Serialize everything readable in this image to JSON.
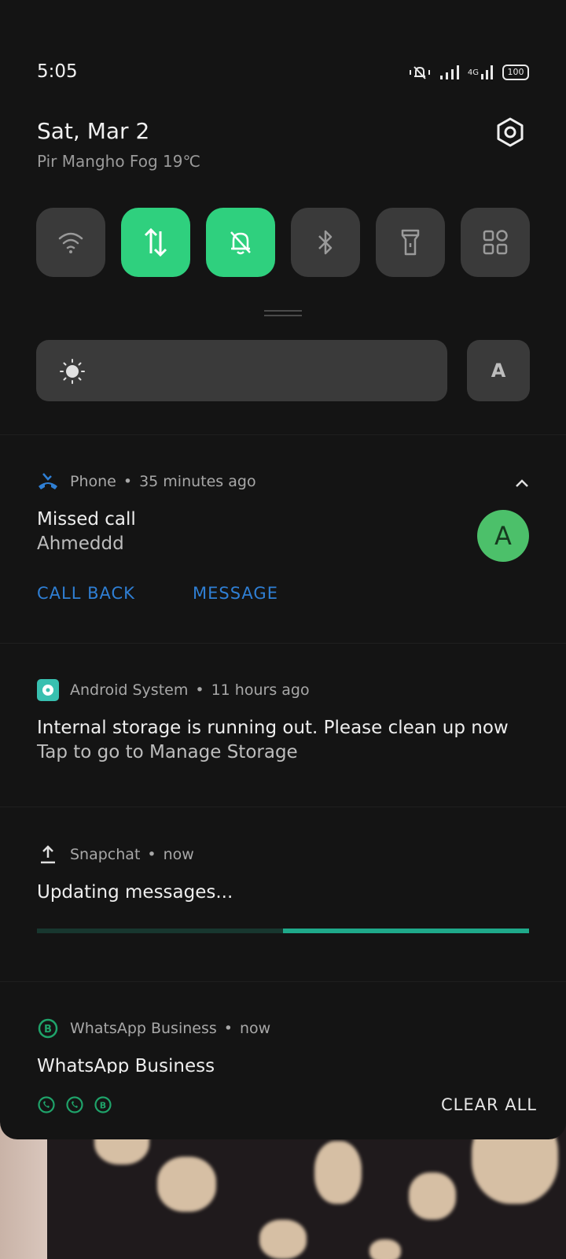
{
  "status_bar": {
    "time": "5:05",
    "battery": "100",
    "network": "4G"
  },
  "header": {
    "date": "Sat, Mar 2",
    "weather": "Pir Mangho Fog 19℃"
  },
  "quick_settings": {
    "tiles": [
      {
        "icon": "wifi-icon",
        "active": false
      },
      {
        "icon": "mobile-data-icon",
        "active": true
      },
      {
        "icon": "silent-bell-icon",
        "active": true
      },
      {
        "icon": "bluetooth-icon",
        "active": false
      },
      {
        "icon": "flashlight-icon",
        "active": false
      },
      {
        "icon": "grid-icon",
        "active": false
      }
    ],
    "auto_brightness_label": "A",
    "brightness_level": 0
  },
  "notifications": {
    "phone": {
      "app": "Phone",
      "time": "35 minutes ago",
      "title": "Missed call",
      "text": "Ahmeddd",
      "avatar_letter": "A",
      "actions": [
        "CALL BACK",
        "MESSAGE"
      ]
    },
    "android_system": {
      "app": "Android System",
      "time": "11 hours ago",
      "title": "Internal storage is running out. Please clean up now",
      "text": "Tap to go to Manage Storage"
    },
    "snapchat": {
      "app": "Snapchat",
      "time": "now",
      "title": "Updating messages...",
      "progress": 0.5
    },
    "whatsapp": {
      "app": "WhatsApp Business",
      "time": "now",
      "title": "WhatsApp Business"
    }
  },
  "footer": {
    "clear_all": "CLEAR ALL"
  },
  "colors": {
    "accent_green": "#2fd07e",
    "link_blue": "#2f7fd4",
    "progress_teal": "#1fa98a"
  }
}
